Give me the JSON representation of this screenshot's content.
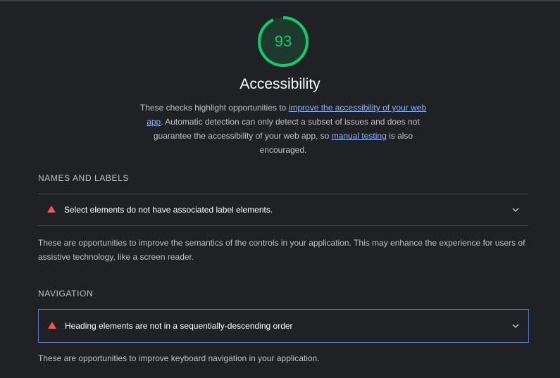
{
  "score": {
    "value": "93",
    "fraction": 0.93,
    "color": "#0cce6b"
  },
  "category": {
    "title": "Accessibility",
    "desc_part1": "These checks highlight opportunities to ",
    "desc_link1": "improve the accessibility of your web app",
    "desc_part2": ". Automatic detection can only detect a subset of issues and does not guarantee the accessibility of your web app, so ",
    "desc_link2": "manual testing",
    "desc_part3": " is also encouraged."
  },
  "groups": [
    {
      "heading": "NAMES AND LABELS",
      "audit_title": "Select elements do not have associated label elements.",
      "audit_status": "fail",
      "description": "These are opportunities to improve the semantics of the controls in your application. This may enhance the experience for users of assistive technology, like a screen reader."
    },
    {
      "heading": "NAVIGATION",
      "audit_title": "Heading elements are not in a sequentially-descending order",
      "audit_status": "fail",
      "description": "These are opportunities to improve keyboard navigation in your application."
    }
  ],
  "icons": {
    "fail": "triangle-icon",
    "expand": "chevron-down-icon"
  }
}
